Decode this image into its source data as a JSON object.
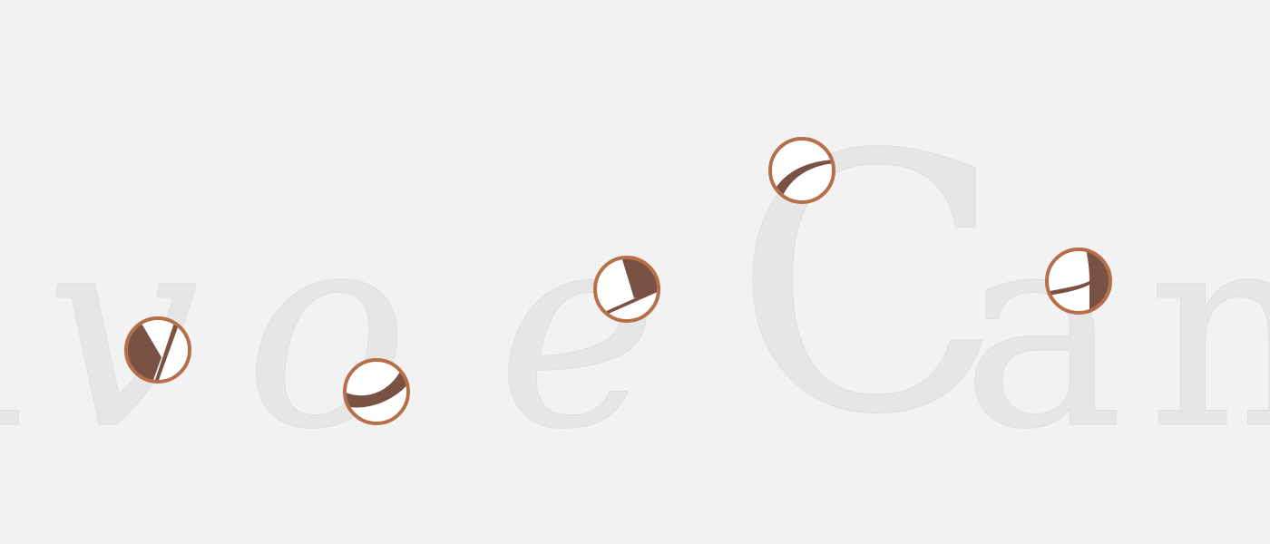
{
  "specimen": {
    "letters": {
      "a1": "a",
      "v": "v",
      "o": "o",
      "e": "e",
      "C": "C",
      "a2": "a",
      "n": "n"
    }
  },
  "colors": {
    "background": "#f2f2f2",
    "glyph_fill": "#e6e6e6",
    "loupe_ring": "#b5704a",
    "loupe_fill": "#7a5244",
    "loupe_inner": "#ffffff"
  },
  "loupes": [
    {
      "name": "detail-loupe-v"
    },
    {
      "name": "detail-loupe-o"
    },
    {
      "name": "detail-loupe-e"
    },
    {
      "name": "detail-loupe-C"
    },
    {
      "name": "detail-loupe-a"
    }
  ]
}
